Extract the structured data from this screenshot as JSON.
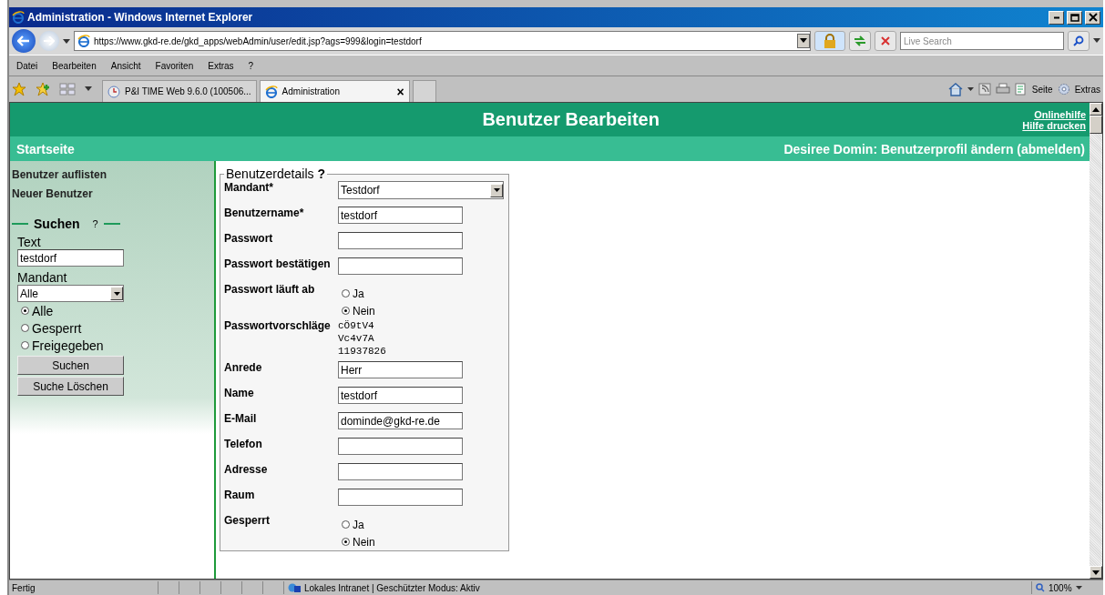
{
  "window": {
    "title": "Administration - Windows Internet Explorer"
  },
  "address_bar": {
    "url": "https://www.gkd-re.de/gkd_apps/webAdmin/user/edit.jsp?ags=999&login=testdorf"
  },
  "search": {
    "placeholder": "Live Search"
  },
  "menu": [
    "Datei",
    "Bearbeiten",
    "Ansicht",
    "Favoriten",
    "Extras",
    "?"
  ],
  "tabs": [
    {
      "label": "P&I TIME Web 9.6.0 (100506...",
      "selected": false
    },
    {
      "label": "Administration",
      "selected": true
    }
  ],
  "tab_close": "×",
  "command_bar": [
    "Seite",
    "Extras"
  ],
  "page": {
    "title": "Benutzer Bearbeiten",
    "help_links": [
      "Onlinehilfe",
      "Hilfe drucken"
    ],
    "home_link": "Startseite",
    "user_line": "Desiree Domin: Benutzerprofil ändern (abmelden)"
  },
  "sidebar": {
    "links": [
      "Benutzer auflisten",
      "Neuer Benutzer"
    ],
    "search": {
      "legend": "Suchen",
      "help": "?",
      "text_label": "Text",
      "text_value": "testdorf",
      "mandant_label": "Mandant",
      "mandant_value": "Alle",
      "radios": [
        {
          "label": "Alle",
          "selected": true
        },
        {
          "label": "Gesperrt",
          "selected": false
        },
        {
          "label": "Freigegeben",
          "selected": false
        }
      ],
      "buttons": [
        "Suchen",
        "Suche Löschen"
      ]
    }
  },
  "form": {
    "legend": "Benutzerdetails",
    "help": "?",
    "fields": [
      {
        "kind": "select",
        "label": "Mandant*",
        "value": "Testdorf"
      },
      {
        "kind": "text",
        "label": "Benutzername*",
        "value": "testdorf"
      },
      {
        "kind": "text",
        "label": "Passwort"
      },
      {
        "kind": "text",
        "label": "Passwort bestätigen"
      },
      {
        "kind": "radio",
        "label": "Passwort läuft ab",
        "options": [
          {
            "label": "Ja",
            "selected": false
          },
          {
            "label": "Nein",
            "selected": true
          }
        ]
      },
      {
        "kind": "mono",
        "label": "Passwortvorschläge",
        "lines": [
          "cÖ9tV4",
          "Vc4v7A",
          "11937826"
        ]
      },
      {
        "kind": "text",
        "label": "Anrede",
        "value": "Herr"
      },
      {
        "kind": "text",
        "label": "Name",
        "value": "testdorf"
      },
      {
        "kind": "text",
        "label": "E-Mail",
        "value": "dominde@gkd-re.de"
      },
      {
        "kind": "text",
        "label": "Telefon"
      },
      {
        "kind": "text",
        "label": "Adresse"
      },
      {
        "kind": "text",
        "label": "Raum"
      },
      {
        "kind": "radio",
        "label": "Gesperrt",
        "options": [
          {
            "label": "Ja",
            "selected": false
          },
          {
            "label": "Nein",
            "selected": true
          }
        ]
      }
    ]
  },
  "status_bar": {
    "text": "Fertig",
    "zone": "Lokales Intranet | Geschützter Modus: Aktiv",
    "zoom": "100%"
  }
}
